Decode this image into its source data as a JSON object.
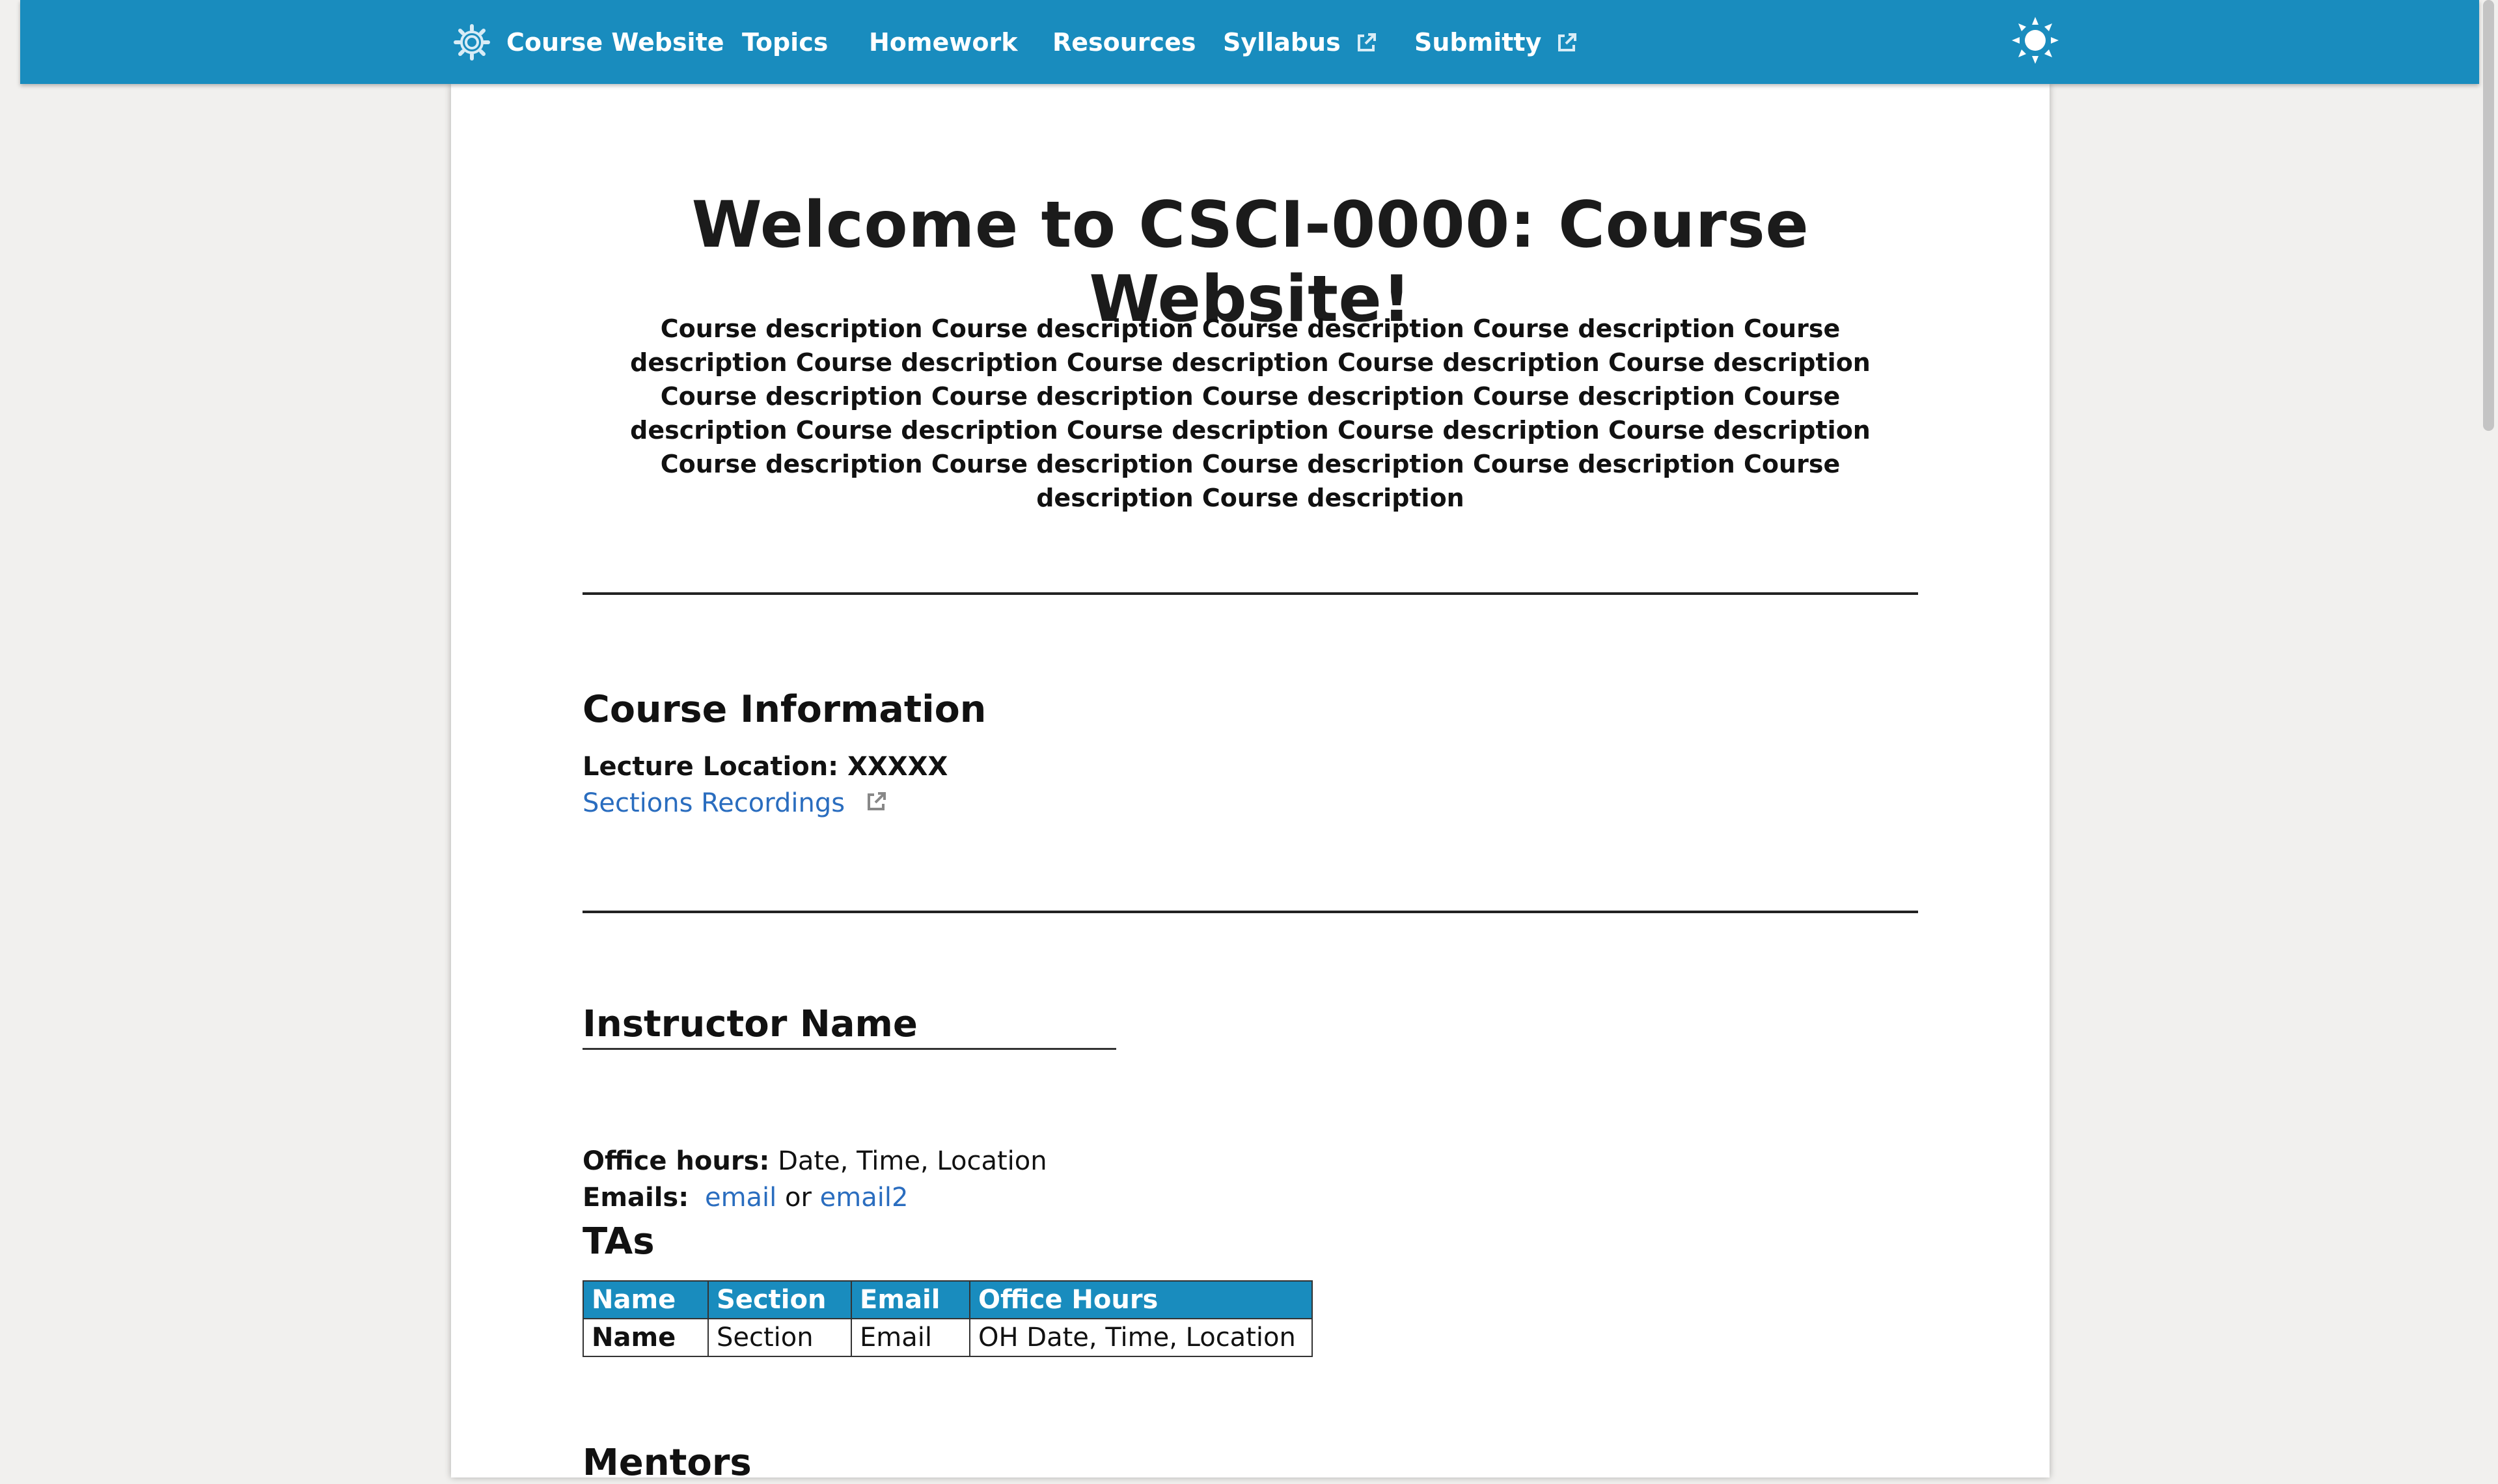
{
  "nav": {
    "brand": "Course Website",
    "items": [
      {
        "label": "Topics"
      },
      {
        "label": "Homework"
      },
      {
        "label": "Resources"
      },
      {
        "label": "Syllabus"
      },
      {
        "label": "Submitty"
      }
    ]
  },
  "main": {
    "title": "Welcome to CSCI-0000: Course Website!",
    "description": "Course description Course description Course description Course description Course description Course description Course description Course description Course description Course description Course description Course description Course description Course description Course description Course description Course description Course description Course description Course description Course description Course description Course description Course description",
    "course_info": {
      "heading": "Course Information",
      "lecture_label": "Lecture Location:",
      "lecture_value": "XXXXX",
      "recordings_link": "Sections Recordings"
    },
    "instructor": {
      "name": "Instructor Name",
      "office_hours_label": "Office hours:",
      "office_hours_value": "Date, Time, Location",
      "emails_label": "Emails:",
      "email1": "email",
      "or_text": "or",
      "email2": "email2"
    },
    "tas": {
      "heading": "TAs",
      "columns": [
        "Name",
        "Section",
        "Email",
        "Office Hours"
      ],
      "rows": [
        [
          "Name",
          "Section",
          "Email",
          "OH Date, Time, Location"
        ]
      ]
    },
    "mentors_heading": "Mentors"
  },
  "colors": {
    "navbar": "#198cbe",
    "link": "#2a6dbf",
    "page_bg": "#f1f0ee"
  },
  "icons": [
    "gear-icon",
    "external-link-icon",
    "sun-icon"
  ]
}
